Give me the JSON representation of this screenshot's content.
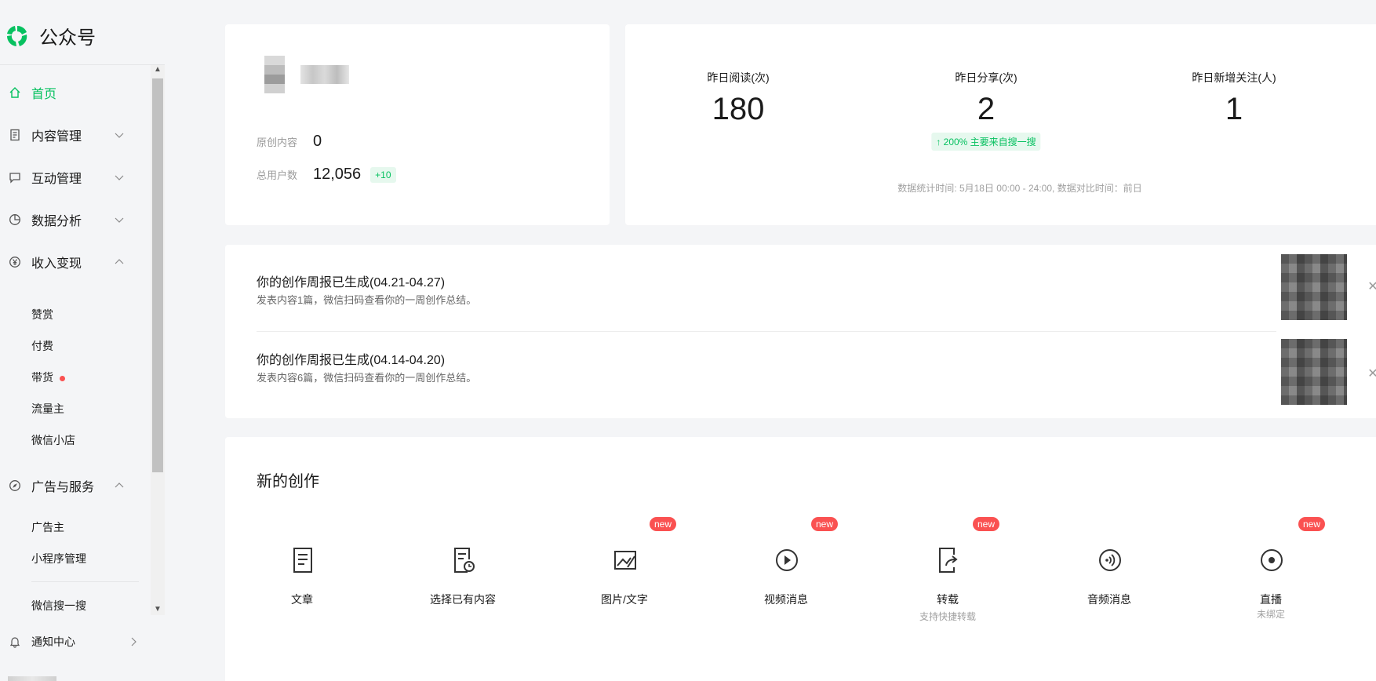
{
  "app": {
    "title": "公众号"
  },
  "colors": {
    "brand": "#07c160",
    "badge_red": "#fa5151"
  },
  "sidebar": {
    "items": [
      {
        "label": "首页",
        "icon": "home-icon",
        "active": true
      },
      {
        "label": "内容管理",
        "icon": "document-icon"
      },
      {
        "label": "互动管理",
        "icon": "chat-icon"
      },
      {
        "label": "数据分析",
        "icon": "pie-chart-icon"
      },
      {
        "label": "收入变现",
        "icon": "yen-icon"
      },
      {
        "label": "广告与服务",
        "icon": "compass-icon"
      }
    ],
    "income_sub": [
      "赞赏",
      "付费",
      "带货",
      "流量主",
      "微信小店"
    ],
    "ads_sub": [
      "广告主",
      "小程序管理",
      "微信搜一搜"
    ],
    "notice": {
      "label": "通知中心",
      "icon": "bell-icon"
    }
  },
  "account": {
    "original_label": "原创内容",
    "original_value": "0",
    "users_label": "总用户数",
    "users_value": "12,056",
    "users_delta": "+10"
  },
  "stats": {
    "read_label": "昨日阅读(次)",
    "read_value": "180",
    "share_label": "昨日分享(次)",
    "share_value": "2",
    "share_trend": "↑ 200%   主要来自搜一搜",
    "follow_label": "昨日新增关注(人)",
    "follow_value": "1",
    "note": "数据统计时间: 5月18日 00:00 - 24:00, 数据对比时间：前日"
  },
  "reports": [
    {
      "title": "你的创作周报已生成(04.21-04.27)",
      "desc": "发表内容1篇，微信扫码查看你的一周创作总结。"
    },
    {
      "title": "你的创作周报已生成(04.14-04.20)",
      "desc": "发表内容6篇，微信扫码查看你的一周创作总结。"
    }
  ],
  "create": {
    "title": "新的创作",
    "new_badge": "new",
    "tools": [
      {
        "label": "文章",
        "icon": "article-icon",
        "sub": "",
        "new": false
      },
      {
        "label": "选择已有内容",
        "icon": "existing-content-icon",
        "sub": "",
        "new": false
      },
      {
        "label": "图片/文字",
        "icon": "image-text-icon",
        "sub": "",
        "new": true
      },
      {
        "label": "视频消息",
        "icon": "video-icon",
        "sub": "",
        "new": true
      },
      {
        "label": "转载",
        "icon": "repost-icon",
        "sub": "支持快捷转载",
        "new": true
      },
      {
        "label": "音频消息",
        "icon": "audio-icon",
        "sub": "",
        "new": false
      },
      {
        "label": "直播",
        "icon": "live-icon",
        "sub": "未绑定",
        "new": true
      }
    ]
  }
}
